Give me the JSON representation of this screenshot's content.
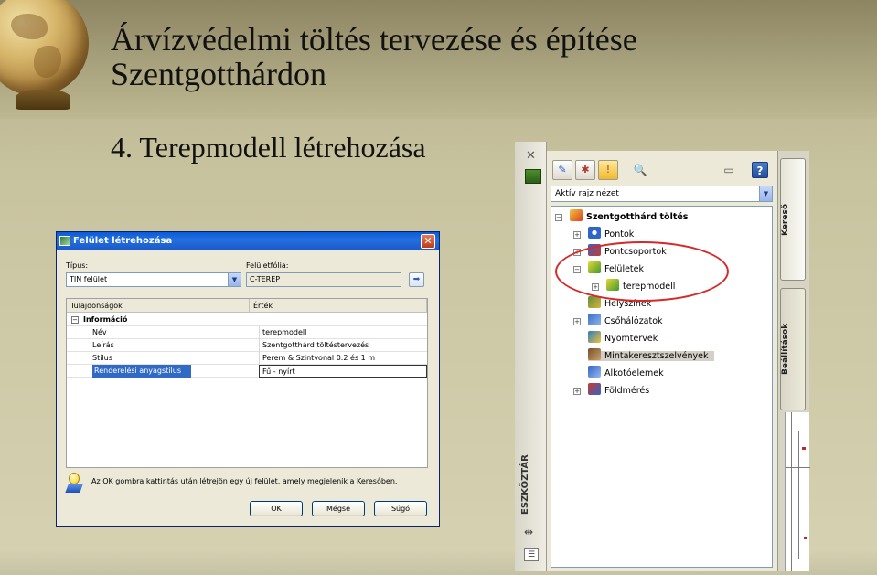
{
  "slide": {
    "title": "Árvízvédelmi töltés tervezése és építése Szentgotthárdon",
    "subtitle": "4.  Terepmodell létrehozása"
  },
  "dialog": {
    "title": "Felület létrehozása",
    "type_label": "Típus:",
    "type_value": "TIN felület",
    "layer_label": "Felületfólia:",
    "layer_value": "C-TEREP",
    "grid": {
      "col_property": "Tulajdonságok",
      "col_value": "Érték",
      "category": "Információ",
      "rows": [
        {
          "name": "Név",
          "value": "terepmodell"
        },
        {
          "name": "Leírás",
          "value": "Szentgotthárd töltéstervezés"
        },
        {
          "name": "Stílus",
          "value": "Perem & Szintvonal 0.2 és 1 m"
        },
        {
          "name": "Renderelési anyagstílus",
          "value": "Fű - nyírt"
        }
      ]
    },
    "info_text": "Az OK gombra kattintás után létrejön egy új felület, amely megjelenik a Keresőben.",
    "buttons": {
      "ok": "OK",
      "cancel": "Mégse",
      "help": "Súgó"
    }
  },
  "toolspace": {
    "side_title": "ESZKÖZTÁR",
    "view_select": "Aktív rajz nézet",
    "tabs": {
      "search": "Kereső",
      "settings": "Beállítások"
    },
    "tree": {
      "root": "Szentgotthárd töltés",
      "items": [
        "Pontok",
        "Pontcsoportok",
        "Felületek",
        "terepmodell",
        "Helyszínek",
        "Csőhálózatok",
        "Nyomtervek",
        "Mintakeresztszelvények",
        "Alkotóelemek",
        "Földmérés"
      ]
    }
  },
  "colors": {
    "highlight_ring": "#d62a2a",
    "titlebar": "#0a5bd8",
    "selection": "#316ac5"
  }
}
